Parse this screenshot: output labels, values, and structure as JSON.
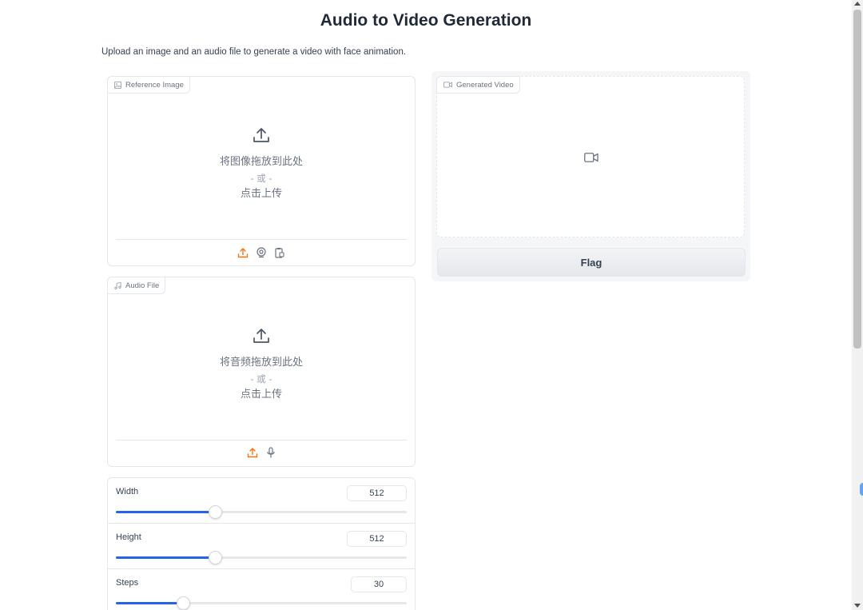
{
  "page": {
    "title": "Audio to Video Generation",
    "description": "Upload an image and an audio file to generate a video with face animation."
  },
  "reference_image": {
    "label": "Reference Image",
    "icon": "image-icon",
    "drop_text": "将图像拖放到此处",
    "or_text": "- 或 -",
    "click_text": "点击上传",
    "sources": [
      "upload-icon",
      "webcam-icon",
      "clipboard-icon"
    ]
  },
  "audio_file": {
    "label": "Audio File",
    "icon": "music-icon",
    "drop_text": "将音频拖放到此处",
    "or_text": "- 或 -",
    "click_text": "点击上传",
    "sources": [
      "upload-icon",
      "microphone-icon"
    ]
  },
  "generated_video": {
    "label": "Generated Video",
    "icon": "video-icon"
  },
  "flag_button": {
    "label": "Flag"
  },
  "sliders": [
    {
      "label": "Width",
      "value": "512",
      "level": 0.34
    },
    {
      "label": "Height",
      "value": "512",
      "level": 0.34
    },
    {
      "label": "Steps",
      "value": "30",
      "level": 0.23
    }
  ],
  "colors": {
    "accent": "#f97316",
    "slider_fill": "#2563eb"
  }
}
